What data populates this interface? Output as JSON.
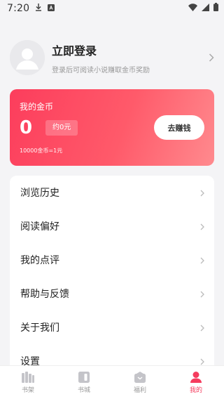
{
  "status_bar": {
    "time": "7:20",
    "icons": [
      "download-icon",
      "app-notification-icon",
      "wifi-icon",
      "signal-icon",
      "battery-icon"
    ]
  },
  "profile": {
    "title": "立即登录",
    "subtitle": "登录后可阅读小说赚取金币奖励",
    "avatar_icon": "default-avatar-icon"
  },
  "coins": {
    "label": "我的金币",
    "value": "0",
    "approx": "约0元",
    "rate": "10000金币=1元",
    "button": "去赚钱"
  },
  "menu": {
    "items": [
      {
        "label": "浏览历史"
      },
      {
        "label": "阅读偏好"
      },
      {
        "label": "我的点评"
      },
      {
        "label": "帮助与反馈"
      },
      {
        "label": "关于我们"
      },
      {
        "label": "设置"
      }
    ]
  },
  "tabs": [
    {
      "label": "书架",
      "icon": "bookshelf-icon"
    },
    {
      "label": "书城",
      "icon": "bookstore-icon"
    },
    {
      "label": "福利",
      "icon": "welfare-icon"
    },
    {
      "label": "我的",
      "icon": "profile-icon"
    }
  ],
  "colors": {
    "accent": "#f53c5e",
    "card_gradient_start": "#fc3d5c",
    "card_gradient_end": "#ff8a8e",
    "background": "#f4f4f6"
  }
}
